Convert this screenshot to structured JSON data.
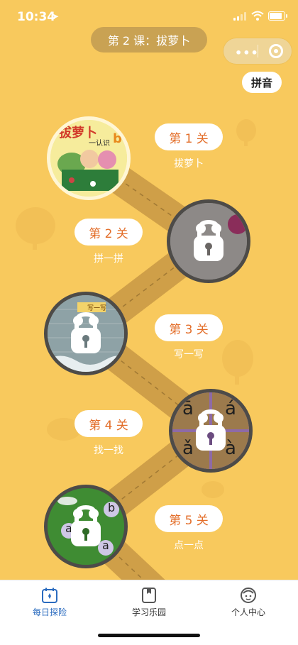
{
  "status_bar": {
    "time": "10:34",
    "location_icon": "location-arrow-icon"
  },
  "header": {
    "lesson_title": "第 2 课：拔萝卜",
    "menu_icon": "more-dots-icon",
    "close_icon": "target-close-icon",
    "pinyin_button": "拼音"
  },
  "levels": [
    {
      "label": "第 1 关",
      "subtitle": "拔萝卜",
      "locked": false,
      "thumb_title": "拔萝卜",
      "thumb_caption": "一认识",
      "thumb_letter": "b"
    },
    {
      "label": "第 2 关",
      "subtitle": "拼一拼",
      "locked": true
    },
    {
      "label": "第 3 关",
      "subtitle": "写一写",
      "locked": true,
      "thumb_tag": "写一写"
    },
    {
      "label": "第 4 关",
      "subtitle": "找一找",
      "locked": true,
      "thumb_letters": [
        "ā",
        "á",
        "ǎ",
        "à"
      ]
    },
    {
      "label": "第 5 关",
      "subtitle": "点一点",
      "locked": true,
      "thumb_letters": [
        "b",
        "a",
        "a"
      ]
    }
  ],
  "tabbar": {
    "items": [
      {
        "label": "每日探险",
        "icon": "calendar-icon",
        "active": true
      },
      {
        "label": "学习乐园",
        "icon": "book-icon",
        "active": false
      },
      {
        "label": "个人中心",
        "icon": "person-icon",
        "active": false
      }
    ]
  },
  "colors": {
    "background": "#f8c95d",
    "accent": "#e36e2a",
    "active_tab": "#2a6bbf"
  }
}
